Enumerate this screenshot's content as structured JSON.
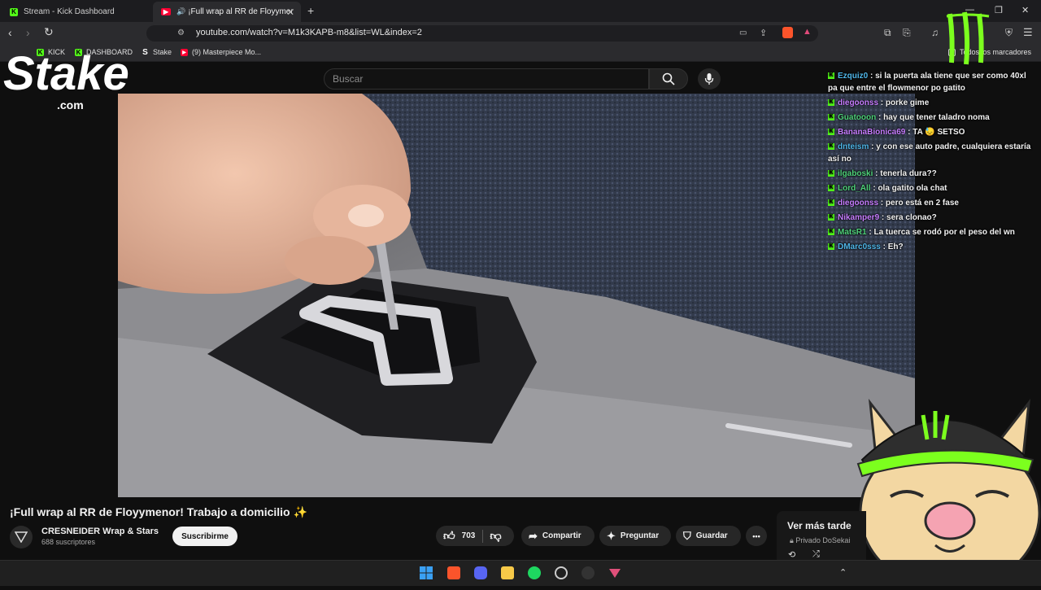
{
  "browser": {
    "tabs": [
      {
        "label": "Stream - Kick Dashboard"
      },
      {
        "label": "¡Full wrap al RR de Floyymenor"
      }
    ],
    "new_tab": "+",
    "address": "youtube.com/watch?v=M1k3KAPB-m8&list=WL&index=2",
    "bookmarks": [
      {
        "label": "KICK"
      },
      {
        "label": "DASHBOARD"
      },
      {
        "label": "Stake"
      },
      {
        "label": "(9) Masterpiece Mo..."
      }
    ],
    "all_bookmarks": "Todos los marcadores"
  },
  "overlay": {
    "stake_logo": "Stake",
    "stake_sub": ".com"
  },
  "youtube": {
    "search_placeholder": "Buscar",
    "video_title": "¡Full wrap al RR de Floyymenor! Trabajo a domicilio ✨",
    "channel_name": "CRESNEIDER Wrap & Stars",
    "channel_subs": "688 suscriptores",
    "subscribe_label": "Suscribirme",
    "likes": "703",
    "share_label": "Compartir",
    "ask_label": "Preguntar",
    "save_label": "Guardar",
    "more_label": "•••",
    "see_later_title": "Ver más tarde",
    "see_later_sub": "Privado DoSekai"
  },
  "chat": [
    {
      "user": "Ezquiz0",
      "color": "#4fb6e8",
      "text": ": si la puerta ala tiene que ser como 40xl pa que entre el flowmenor po gatito"
    },
    {
      "user": "diegoonss",
      "color": "#c77dff",
      "text": ": porke gime"
    },
    {
      "user": "Guatooon",
      "color": "#4fd27a",
      "text": ": hay que tener taladro noma"
    },
    {
      "user": "BananaBionica69",
      "color": "#c77dff",
      "text": ": TA 😓 SETSO"
    },
    {
      "user": "dnteism",
      "color": "#4fb6e8",
      "text": ": y con ese auto padre, cualquiera estaría así no"
    },
    {
      "user": "ilgaboski",
      "color": "#4fd27a",
      "text": ": tenerla dura??"
    },
    {
      "user": "Lord_All",
      "color": "#4fd27a",
      "text": ": ola gatito ola chat"
    },
    {
      "user": "diegoonss",
      "color": "#c77dff",
      "text": ": pero está en 2 fase"
    },
    {
      "user": "Nikamper9",
      "color": "#c77dff",
      "text": ": sera clonao?"
    },
    {
      "user": "MatsR1",
      "color": "#4fd27a",
      "text": ": La tuerca se rodó por el peso del wn"
    },
    {
      "user": "DMarc0sss",
      "color": "#4fb6e8",
      "text": ": Eh?"
    }
  ],
  "colors": {
    "kick_green": "#53fc18",
    "yt_red": "#ff0033",
    "monster_green": "#7cff1e"
  }
}
